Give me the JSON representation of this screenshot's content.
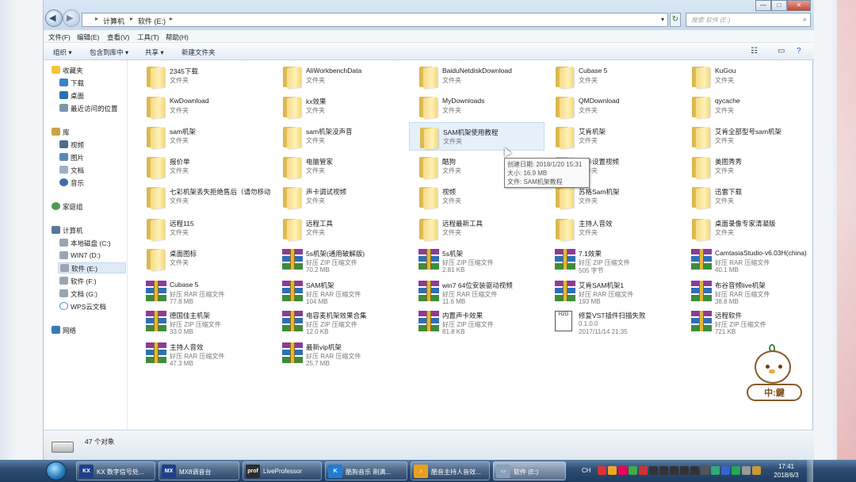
{
  "window": {
    "breadcrumb": [
      "计算机",
      "软件 (E:)"
    ],
    "search_placeholder": "搜索 软件 (E:)",
    "controls": {
      "minimize": "—",
      "maximize": "□",
      "close": "✕"
    }
  },
  "menu": [
    "文件(F)",
    "编辑(E)",
    "查看(V)",
    "工具(T)",
    "帮助(H)"
  ],
  "toolbar": {
    "organize": "组织 ▾",
    "include_library": "包含到库中 ▾",
    "share": "共享 ▾",
    "new_folder": "新建文件夹"
  },
  "sidebar": {
    "favorites": "收藏夹",
    "favorites_items": [
      "下载",
      "桌面",
      "最近访问的位置"
    ],
    "libraries": "库",
    "library_items": [
      "视频",
      "图片",
      "文档",
      "音乐"
    ],
    "homegroup": "家庭组",
    "computer": "计算机",
    "drives": [
      "本地磁盘 (C:)",
      "WIN7 (D:)",
      "软件 (E:)",
      "软件 (F:)",
      "文档 (G:)",
      "WPS云文档"
    ],
    "network": "网络"
  },
  "items": [
    {
      "name": "2345下载",
      "type": "文件夹",
      "size": "",
      "kind": "folder"
    },
    {
      "name": "AliWorkbenchData",
      "type": "文件夹",
      "size": "",
      "kind": "folder"
    },
    {
      "name": "BaiduNetdiskDownload",
      "type": "文件夹",
      "size": "",
      "kind": "folder"
    },
    {
      "name": "Cubase 5",
      "type": "文件夹",
      "size": "",
      "kind": "folder"
    },
    {
      "name": "KuGou",
      "type": "文件夹",
      "size": "",
      "kind": "folder"
    },
    {
      "name": "KwDownload",
      "type": "文件夹",
      "size": "",
      "kind": "folder"
    },
    {
      "name": "kx效果",
      "type": "文件夹",
      "size": "",
      "kind": "folder"
    },
    {
      "name": "MyDownloads",
      "type": "文件夹",
      "size": "",
      "kind": "folder"
    },
    {
      "name": "QMDownload",
      "type": "文件夹",
      "size": "",
      "kind": "folder"
    },
    {
      "name": "qycache",
      "type": "文件夹",
      "size": "",
      "kind": "folder"
    },
    {
      "name": "sam机架",
      "type": "文件夹",
      "size": "",
      "kind": "folder"
    },
    {
      "name": "sam机架没声音",
      "type": "文件夹",
      "size": "",
      "kind": "folder"
    },
    {
      "name": "SAM机架使用教程",
      "type": "文件夹",
      "size": "",
      "kind": "folder"
    },
    {
      "name": "艾肯机架",
      "type": "文件夹",
      "size": "",
      "kind": "folder"
    },
    {
      "name": "艾肯全部型号sam机架",
      "type": "文件夹",
      "size": "",
      "kind": "folder"
    },
    {
      "name": "报价单",
      "type": "文件夹",
      "size": "",
      "kind": "folder"
    },
    {
      "name": "电脑管家",
      "type": "文件夹",
      "size": "",
      "kind": "folder"
    },
    {
      "name": "酷狗",
      "type": "文件夹",
      "size": "",
      "kind": "folder"
    },
    {
      "name": "声卡设置视频",
      "type": "文件夹",
      "size": "",
      "kind": "folder"
    },
    {
      "name": "美图秀秀",
      "type": "文件夹",
      "size": "",
      "kind": "folder"
    },
    {
      "name": "七彩机架丢失拒绝售后（请勿移动）",
      "type": "文件夹",
      "size": "",
      "kind": "folder"
    },
    {
      "name": "声卡调试视频",
      "type": "文件夹",
      "size": "",
      "kind": "folder"
    },
    {
      "name": "视频",
      "type": "文件夹",
      "size": "",
      "kind": "folder"
    },
    {
      "name": "苏格Sam机架",
      "type": "文件夹",
      "size": "",
      "kind": "folder"
    },
    {
      "name": "迅雷下载",
      "type": "文件夹",
      "size": "",
      "kind": "folder"
    },
    {
      "name": "远程115",
      "type": "文件夹",
      "size": "",
      "kind": "folder"
    },
    {
      "name": "远程工具",
      "type": "文件夹",
      "size": "",
      "kind": "folder"
    },
    {
      "name": "远程最新工具",
      "type": "文件夹",
      "size": "",
      "kind": "folder"
    },
    {
      "name": "主持人音效",
      "type": "文件夹",
      "size": "",
      "kind": "folder"
    },
    {
      "name": "桌面录像专家清凝版",
      "type": "文件夹",
      "size": "",
      "kind": "folder"
    },
    {
      "name": "桌面图标",
      "type": "文件夹",
      "size": "",
      "kind": "folder"
    },
    {
      "name": "5s机架(通用破解版)",
      "type": "好压 ZIP 压缩文件",
      "size": "70.2 MB",
      "kind": "rar"
    },
    {
      "name": "5s机架",
      "type": "好压 ZIP 压缩文件",
      "size": "2.81 KB",
      "kind": "rar"
    },
    {
      "name": "7.1效果",
      "type": "好压 ZIP 压缩文件",
      "size": "505 字节",
      "kind": "rar"
    },
    {
      "name": "CamtasiaStudio-v6.03H(china)",
      "type": "好压 RAR 压缩文件",
      "size": "40.1 MB",
      "kind": "rar"
    },
    {
      "name": "Cubase 5",
      "type": "好压 RAR 压缩文件",
      "size": "77.8 MB",
      "kind": "rar"
    },
    {
      "name": "SAM机架",
      "type": "好压 RAR 压缩文件",
      "size": "104 MB",
      "kind": "rar"
    },
    {
      "name": "win7  64位安装驱动视频",
      "type": "好压 RAR 压缩文件",
      "size": "11.6 MB",
      "kind": "rar"
    },
    {
      "name": "艾肯SAM机架1",
      "type": "好压 RAR 压缩文件",
      "size": "193 MB",
      "kind": "rar"
    },
    {
      "name": "布谷音频live机架",
      "type": "好压 RAR 压缩文件",
      "size": "38.8 MB",
      "kind": "rar"
    },
    {
      "name": "德国佳主机架",
      "type": "好压 ZIP 压缩文件",
      "size": "33.0 MB",
      "kind": "rar"
    },
    {
      "name": "电容麦机架效果合集",
      "type": "好压 ZIP 压缩文件",
      "size": "12.0 KB",
      "kind": "rar"
    },
    {
      "name": "内置声卡效果",
      "type": "好压 ZIP 压缩文件",
      "size": "81.8 KB",
      "kind": "rar"
    },
    {
      "name": "修复VST插件扫描失败",
      "type": "0.1.0.0",
      "size": "2017/11/14 21:35",
      "kind": "h2o"
    },
    {
      "name": "远程软件",
      "type": "好压 ZIP 压缩文件",
      "size": "721 KB",
      "kind": "rar"
    },
    {
      "name": "主持人音效",
      "type": "好压 RAR 压缩文件",
      "size": "47.3 MB",
      "kind": "rar"
    },
    {
      "name": "最新vip机架",
      "type": "好压 RAR 压缩文件",
      "size": "25.7 MB",
      "kind": "rar"
    }
  ],
  "tooltip": {
    "created": "创建日期: 2018/1/20 15:31",
    "size": "大小: 16.9 MB",
    "files": "文件: SAM机架教程"
  },
  "h2o_label": "H2O",
  "status": {
    "count": "47 个对象"
  },
  "taskbar": {
    "buttons": [
      {
        "label": "KX 数字信号处...",
        "icon": "KX",
        "color": "#1d3f8a"
      },
      {
        "label": "MX8调音台",
        "icon": "MX",
        "color": "#1d3f8a"
      },
      {
        "label": "LiveProfessor",
        "icon": "prof",
        "color": "#2b2b2b"
      },
      {
        "label": "酷狗音乐 刚满...",
        "icon": "K",
        "color": "#1f7dd6"
      },
      {
        "label": "酷音主持人音效...",
        "icon": "♪",
        "color": "#e8a020"
      },
      {
        "label": "软件 (E:)",
        "icon": "▭",
        "color": "#8aa0b8"
      }
    ],
    "lang": "CH",
    "time": "17:41",
    "date": "2018/6/3"
  },
  "watermark": "中:鍵"
}
